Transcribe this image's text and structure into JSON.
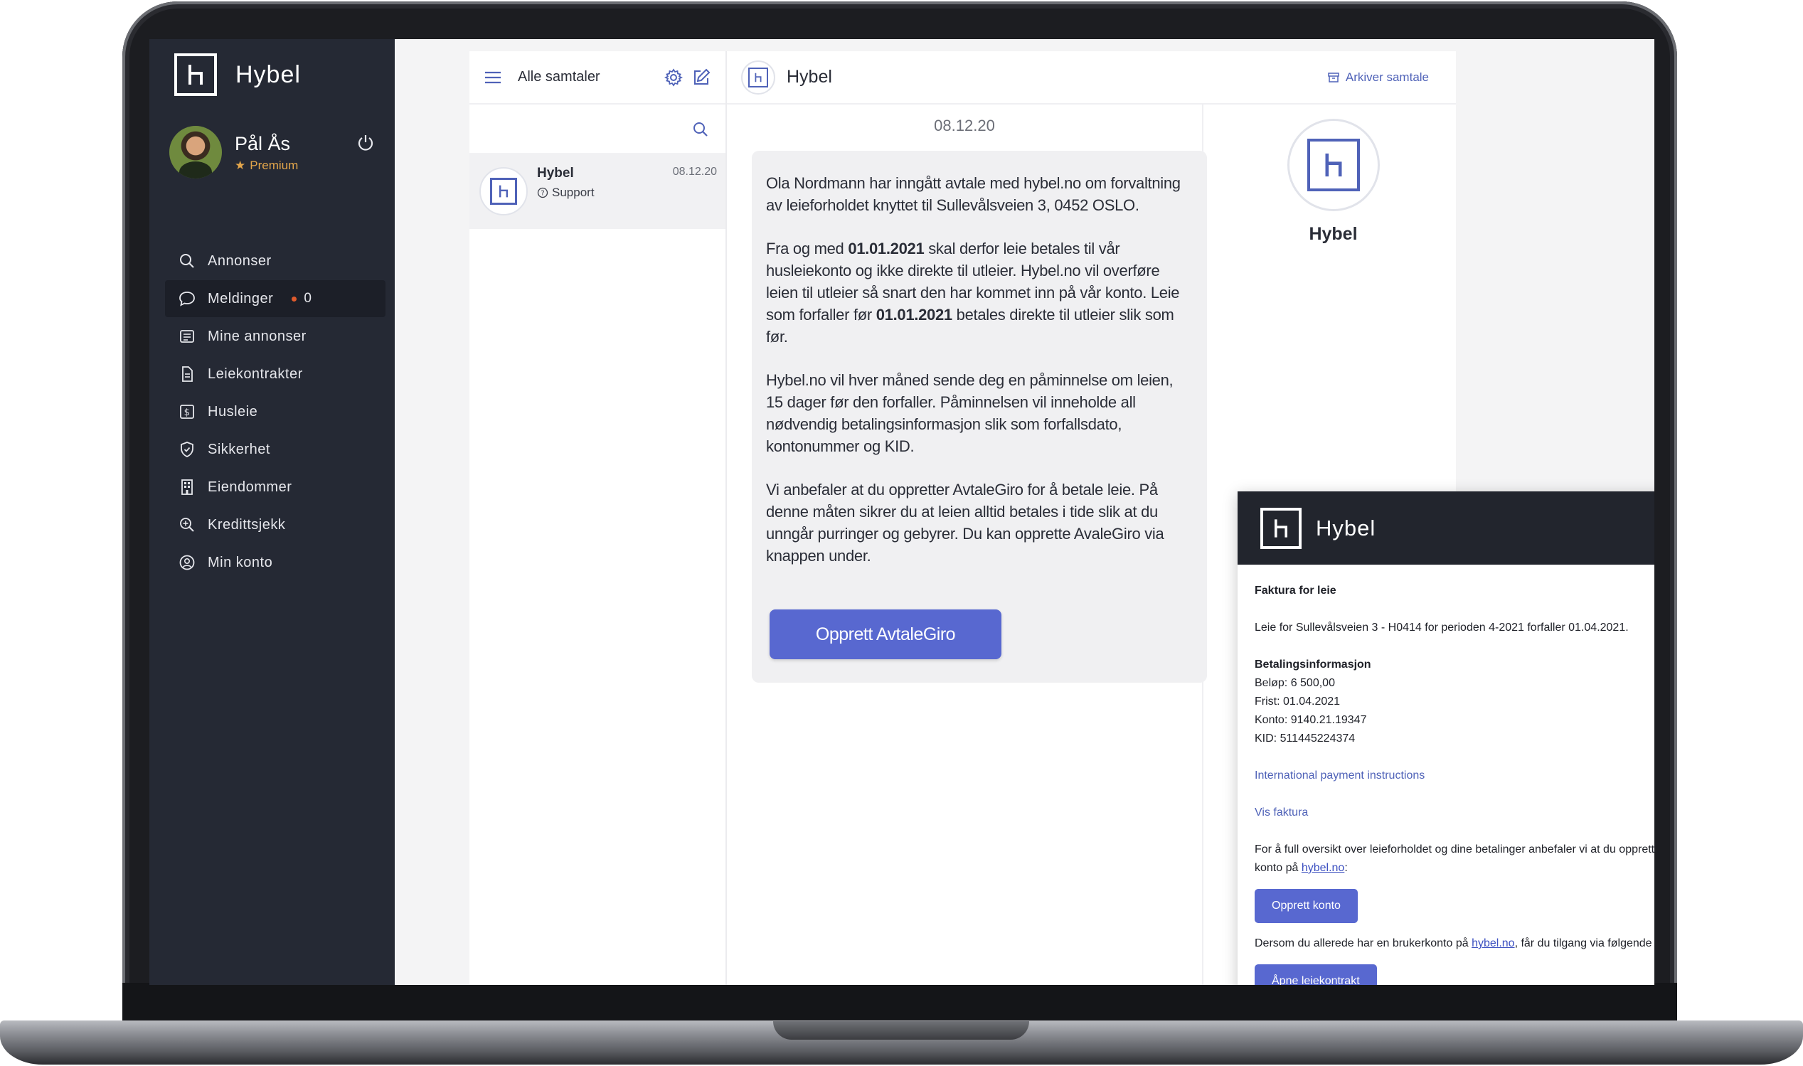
{
  "app": {
    "brand": "Hybel"
  },
  "user": {
    "name": "Pål Ås",
    "tier": "Premium"
  },
  "sidebar": {
    "items": [
      {
        "label": "Annonser",
        "icon": "search-icon"
      },
      {
        "label": "Meldinger",
        "icon": "chat-bubble-icon",
        "count": "0",
        "active": true
      },
      {
        "label": "Mine annonser",
        "icon": "list-icon"
      },
      {
        "label": "Leiekontrakter",
        "icon": "document-icon"
      },
      {
        "label": "Husleie",
        "icon": "dollar-icon"
      },
      {
        "label": "Sikkerhet",
        "icon": "shield-icon"
      },
      {
        "label": "Eiendommer",
        "icon": "building-icon"
      },
      {
        "label": "Kredittsjekk",
        "icon": "magnifier-check-icon"
      },
      {
        "label": "Min konto",
        "icon": "user-circle-icon"
      }
    ]
  },
  "conversations": {
    "title": "Alle samtaler",
    "items": [
      {
        "name": "Hybel",
        "sub": "Support",
        "date": "08.12.20"
      }
    ]
  },
  "chat": {
    "title": "Hybel",
    "archive_label": "Arkiver samtale",
    "date": "08.12.20",
    "message": {
      "p1": "Ola Nordmann har inngått avtale med hybel.no om forvaltning av leieforholdet knyttet til Sullevålsveien 3, 0452 OSLO.",
      "p2_a": "Fra og med ",
      "p2_b": "01.01.2021",
      "p2_c": " skal derfor leie betales til vår husleiekonto og ikke direkte til utleier. Hybel.no vil overføre leien til utleier så snart den har kommet inn på vår konto. Leie som forfaller før ",
      "p2_d": "01.01.2021",
      "p2_e": " betales direkte til utleier slik som før.",
      "p3": "Hybel.no vil hver måned sende deg en påminnelse om leien, 15 dager før den forfaller. Påminnelsen vil inneholde all nødvendig betalingsinformasjon slik som forfallsdato, kontonummer og KID.",
      "p4": "Vi anbefaler at du oppretter AvtaleGiro for å betale leie. På denne måten sikrer du at leien alltid betales i tide slik at du unngår purringer og gebyrer. Du kan opprette AvaleGiro via knappen under.",
      "cta": "Opprett AvtaleGiro"
    },
    "profile_name": "Hybel"
  },
  "email": {
    "brand": "Hybel",
    "title": "Faktura for leie",
    "intro": "Leie for Sullevålsveien 3 - H0414 for perioden 4-2021 forfaller 01.04.2021.",
    "payment_title": "Betalingsinformasjon",
    "amount": "Beløp: 6 500,00",
    "due": "Frist: 01.04.2021",
    "account": "Konto: 9140.21.19347",
    "kid": "KID: 511445224374",
    "intl_link": "International payment instructions",
    "invoice_link": "Vis faktura",
    "overview_text": "For å full oversikt over leieforholdet og dine betalinger anbefaler vi at du oppretter en konto på ",
    "overview_link": "hybel.no",
    "overview_end": ":",
    "create_account": "Opprett konto",
    "existing_text": "Dersom du allerede har en brukerkonto på ",
    "existing_link": "hybel.no",
    "existing_end": ", får du tilgang via følgende lenke:",
    "open_contract": "Åpne leiekontrakt"
  },
  "colors": {
    "sidebar": "#252934",
    "accent": "#5868d0",
    "premium": "#e3a64b",
    "badge": "#e05a2c"
  }
}
